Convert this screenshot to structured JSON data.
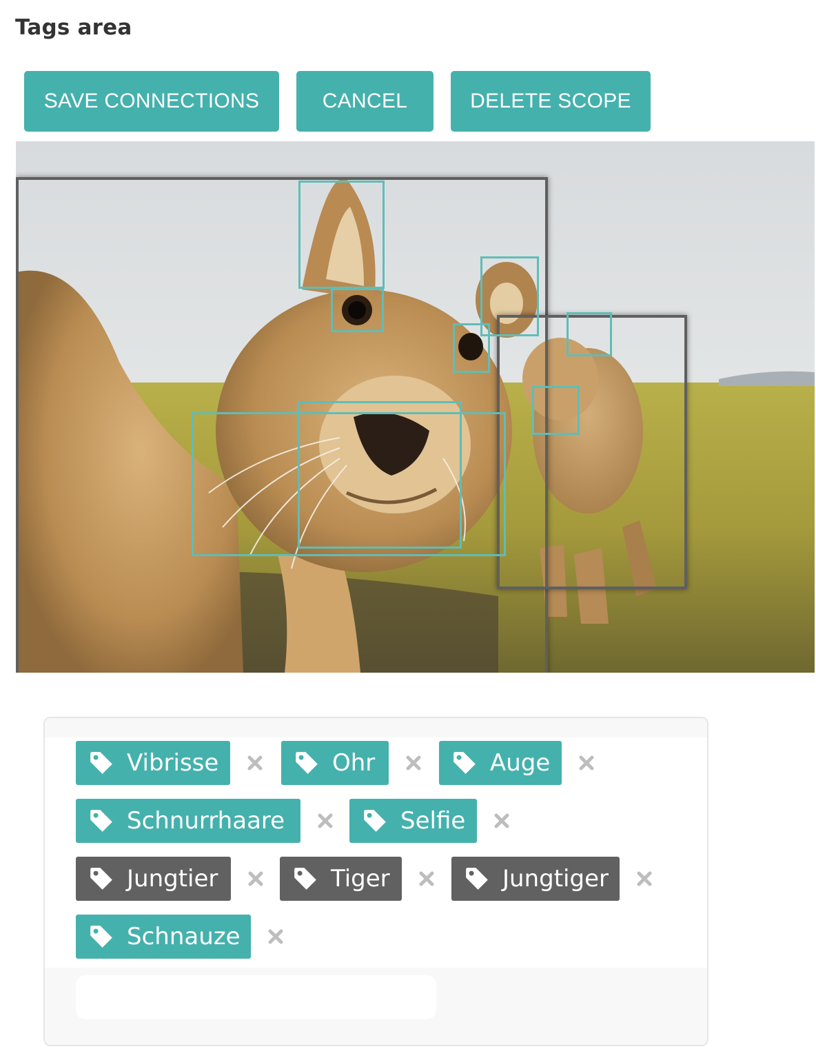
{
  "page": {
    "title": "Tags area"
  },
  "toolbar": {
    "save_label": "SAVE CONNECTIONS",
    "cancel_label": "CANCEL",
    "delete_label": "DELETE SCOPE"
  },
  "colors": {
    "accent": "#45b1ad",
    "scope_tag": "#616161",
    "panel_bg": "#f8f8f8"
  },
  "tags": [
    {
      "label": "Vibrisse",
      "kind": "selected",
      "icon": "tag-icon"
    },
    {
      "label": "Ohr",
      "kind": "selected",
      "icon": "tag-icon"
    },
    {
      "label": "Auge",
      "kind": "selected",
      "icon": "tag-icon"
    },
    {
      "label": "Schnurrhaare",
      "kind": "selected",
      "icon": "tag-icon"
    },
    {
      "label": "Selfie",
      "kind": "selected",
      "icon": "tag-icon"
    },
    {
      "label": "Jungtier",
      "kind": "scope",
      "icon": "tag-icon"
    },
    {
      "label": "Tiger",
      "kind": "scope",
      "icon": "tag-icon"
    },
    {
      "label": "Jungtiger",
      "kind": "scope",
      "icon": "tag-icon"
    },
    {
      "label": "Schnauze",
      "kind": "selected",
      "icon": "tag-icon"
    }
  ],
  "new_tag_input": {
    "value": "",
    "placeholder": ""
  }
}
